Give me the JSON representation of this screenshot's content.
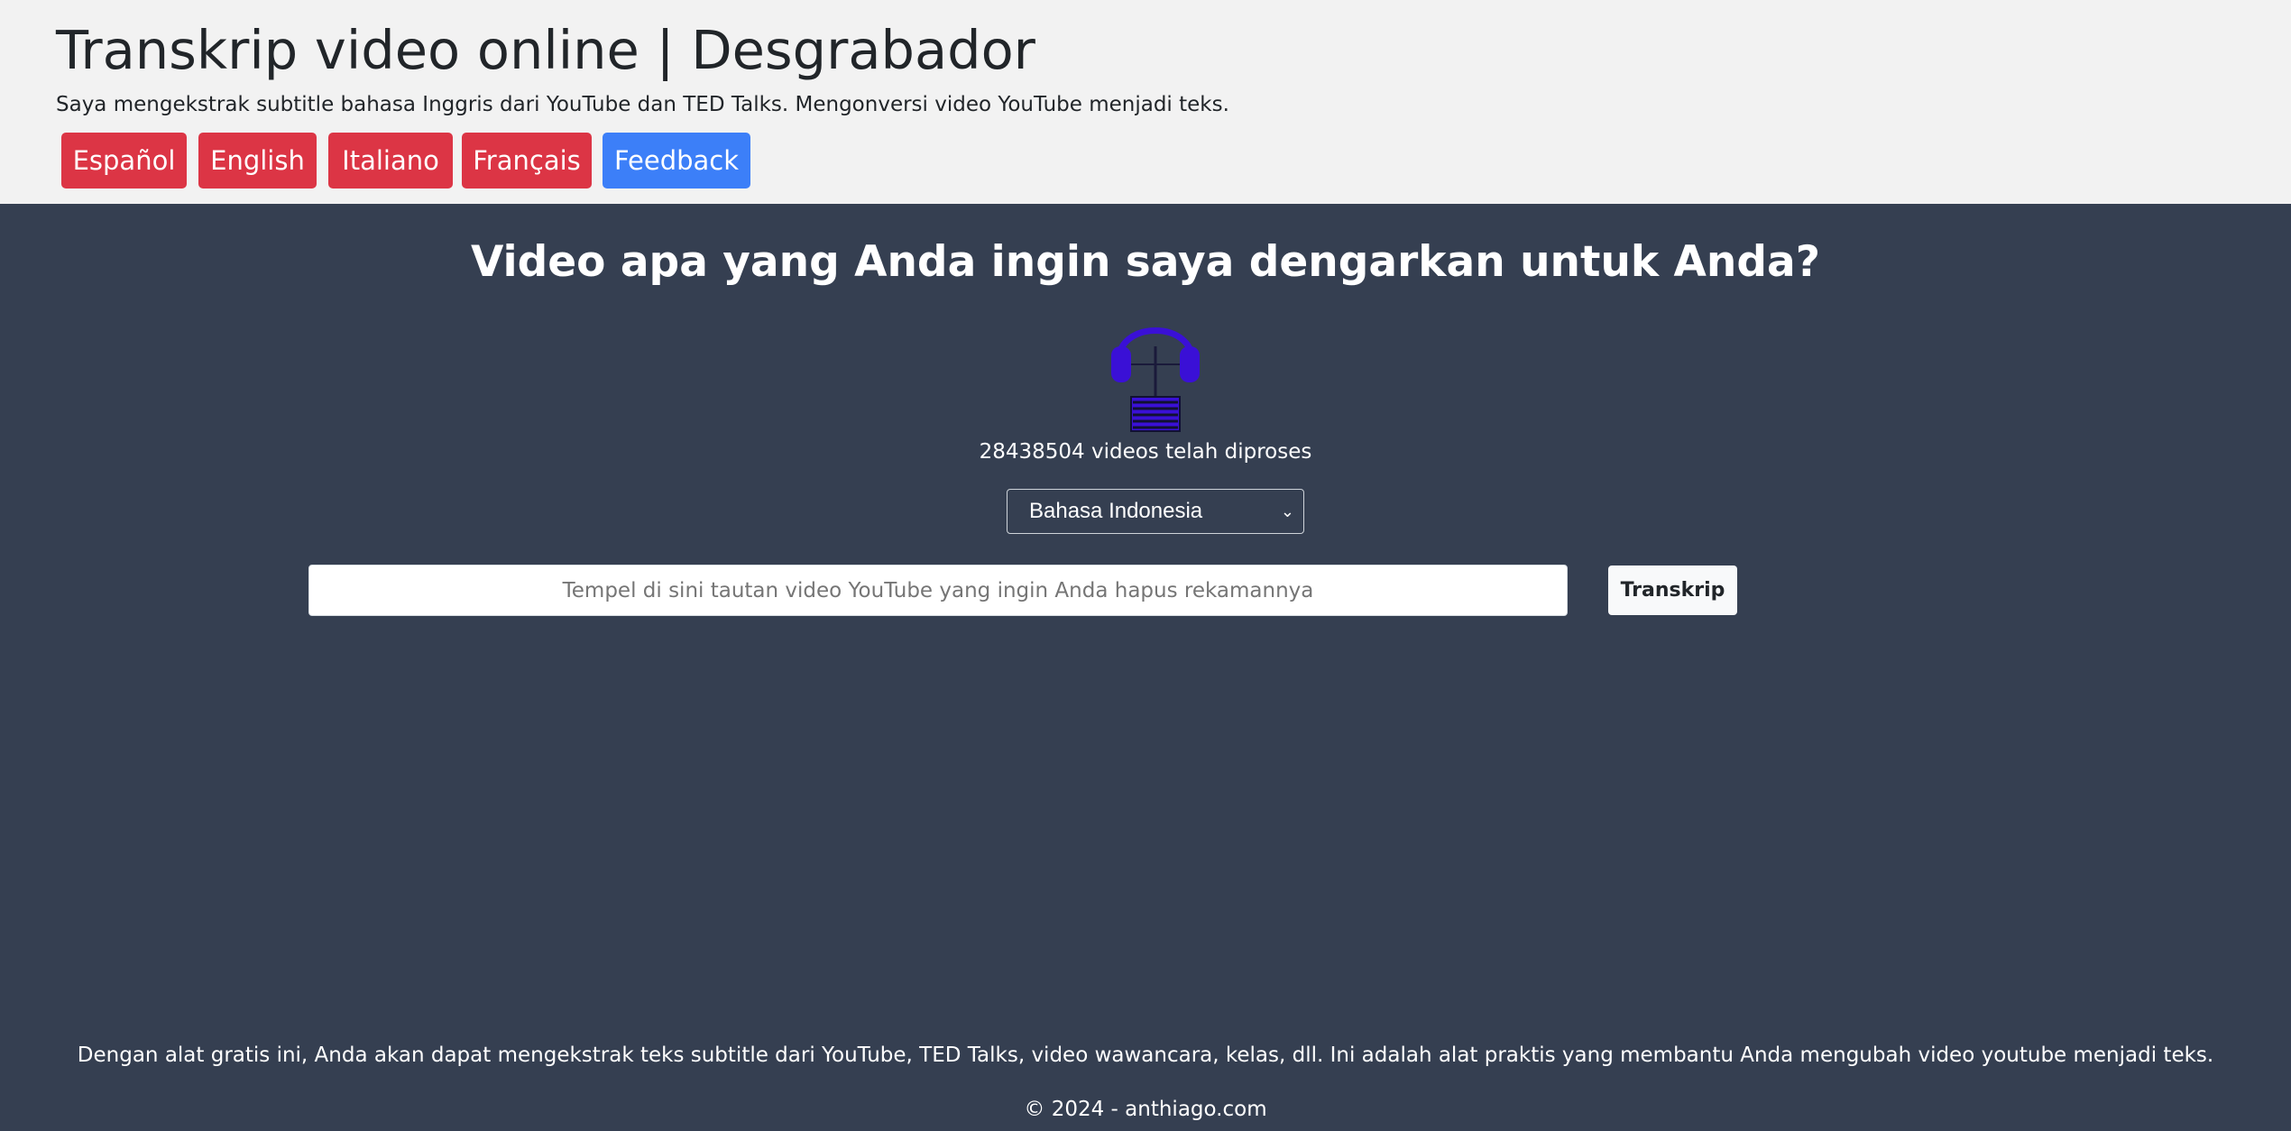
{
  "header": {
    "title": "Transkrip video online | Desgrabador",
    "subtitle": "Saya mengekstrak subtitle bahasa Inggris dari YouTube dan TED Talks. Mengonversi video YouTube menjadi teks.",
    "buttons": [
      {
        "label": "Español",
        "color": "#dc3545"
      },
      {
        "label": "English",
        "color": "#dc3545"
      },
      {
        "label": "Italiano",
        "color": "#dc3545"
      },
      {
        "label": "Français",
        "color": "#dc3545"
      },
      {
        "label": "Feedback",
        "color": "#3c7ff8"
      }
    ]
  },
  "main": {
    "question": "Video apa yang Anda ingin saya dengarkan untuk Anda?",
    "logo_icon": "headphones-icon",
    "count_text": "28438504 videos telah diproses",
    "language_select": {
      "selected": "Bahasa Indonesia"
    },
    "url_input": {
      "placeholder": "Tempel di sini tautan video YouTube yang ingin Anda hapus rekamannya",
      "value": ""
    },
    "transcribe_label": "Transkrip"
  },
  "footer": {
    "description": "Dengan alat gratis ini, Anda akan dapat mengekstrak teks subtitle dari YouTube, TED Talks, video wawancara, kelas, dll. Ini adalah alat praktis yang membantu Anda mengubah video youtube menjadi teks.",
    "copyright": "© 2024 - anthiago.com"
  },
  "colors": {
    "header_bg": "#f2f2f2",
    "main_bg": "#353f51",
    "lang_button": "#dc3545",
    "feedback_button": "#3c7ff8",
    "logo": "#3a10d6"
  }
}
